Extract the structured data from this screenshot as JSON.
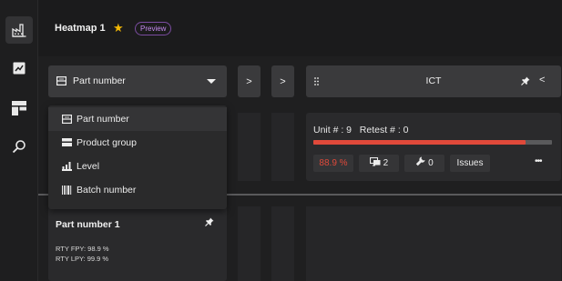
{
  "sidebar": {
    "items": [
      {
        "icon": "factory-icon",
        "active": true
      },
      {
        "icon": "chart-icon",
        "active": false
      },
      {
        "icon": "dashboard-icon",
        "active": false
      },
      {
        "icon": "search-icon",
        "active": false
      }
    ]
  },
  "header": {
    "title": "Heatmap 1",
    "favorite_icon": "star-icon",
    "badge": "Preview"
  },
  "group_selector": {
    "selected": "Part number",
    "options": [
      {
        "label": "Part number",
        "icon": "part-number-icon",
        "selected": true
      },
      {
        "label": "Product group",
        "icon": "product-group-icon",
        "selected": false
      },
      {
        "label": "Level",
        "icon": "level-icon",
        "selected": false
      },
      {
        "label": "Batch number",
        "icon": "barcode-icon",
        "selected": false
      }
    ]
  },
  "nav": {
    "prev_label": ">",
    "next_label": ">"
  },
  "station": {
    "name": "ICT",
    "drag_icon": "drag-handle-icon",
    "pin_icon": "pin-icon",
    "collapse_label": "<"
  },
  "station_card": {
    "unit_text": "Unit # : 9",
    "retest_text": "Retest # : 0",
    "progress_fraction": 0.889,
    "yield_text": "88.9 %",
    "devices_count": "2",
    "repairs_count": "0",
    "issues_label": "Issues",
    "more_label": "•••"
  },
  "part_card": {
    "title": "Part number 1",
    "rty_fpy": "RTY FPY: 98.9 %",
    "rty_lpy": "RTY LPY: 99.9 %"
  },
  "colors": {
    "accent_star": "#f2b705",
    "badge_purple": "#c58bf0",
    "progress_red": "#e0493a",
    "yield_red": "#e0493a"
  }
}
